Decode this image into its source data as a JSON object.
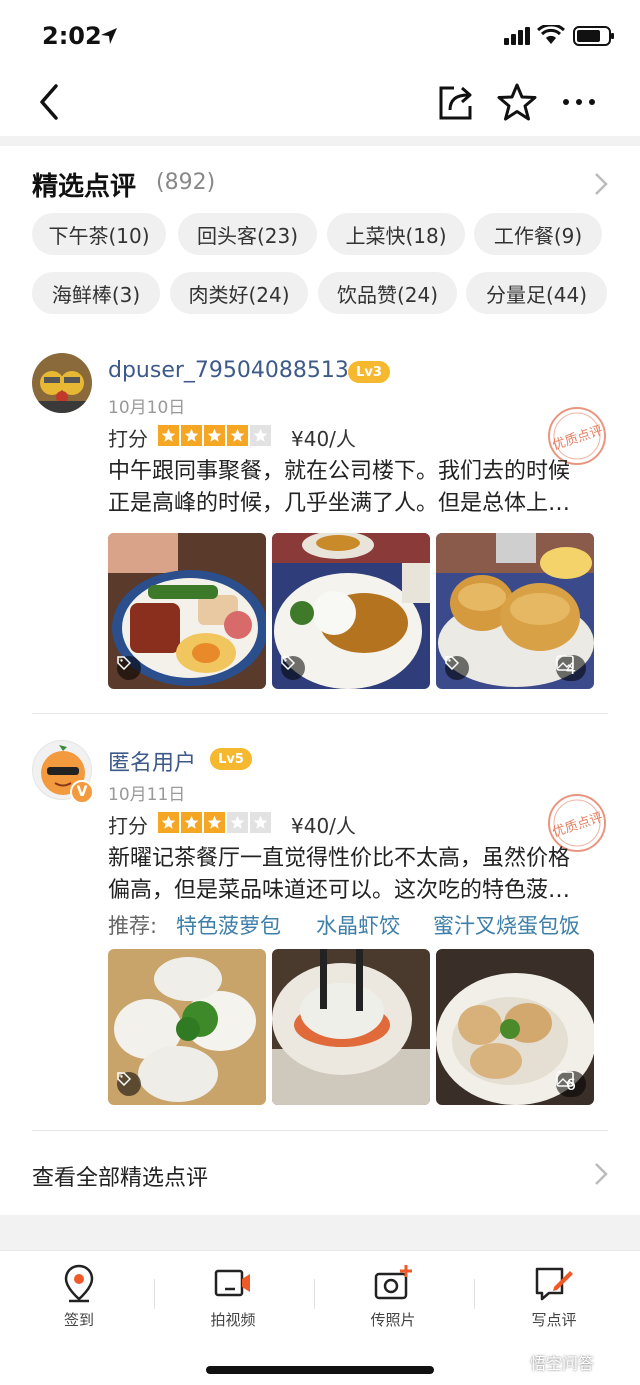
{
  "status_bar": {
    "time": "2:02"
  },
  "section": {
    "title": "精选点评",
    "count": "(892)"
  },
  "tags": [
    "下午茶(10)",
    "回头客(23)",
    "上菜快(18)",
    "工作餐(9)",
    "海鲜棒(3)",
    "肉类好(24)",
    "饮品赞(24)",
    "分量足(44)"
  ],
  "reviews": [
    {
      "username": "dpuser_79504088513",
      "level": "Lv3",
      "date": "10月10日",
      "rating_label": "打分",
      "stars": 4,
      "price": "¥40/人",
      "text_line1": "中午跟同事聚餐，就在公司楼下。我们去的时候",
      "text_line2": "正是高峰的时候，几乎坐满了人。但是总体上…",
      "stamp": "优质点评",
      "photo_count": "4"
    },
    {
      "username": "匿名用户",
      "level": "Lv5",
      "avatar_badge": "V",
      "date": "10月11日",
      "rating_label": "打分",
      "stars": 3,
      "price": "¥40/人",
      "text_line1": "新曜记茶餐厅一直觉得性价比不太高，虽然价格",
      "text_line2": "偏高，但是菜品味道还可以。这次吃的特色菠…",
      "rec_label": "推荐:",
      "recommend": [
        "特色菠萝包",
        "水晶虾饺",
        "蜜汁叉烧蛋包饭"
      ],
      "stamp": "优质点评",
      "photo_count": "6"
    }
  ],
  "see_all": "查看全部精选点评",
  "tabbar": {
    "items": [
      {
        "label": "签到",
        "icon": "location-pin-icon"
      },
      {
        "label": "拍视频",
        "icon": "video-camera-icon"
      },
      {
        "label": "传照片",
        "icon": "photo-upload-icon"
      },
      {
        "label": "写点评",
        "icon": "write-review-icon"
      }
    ]
  },
  "watermark": "悟空问答",
  "colors": {
    "star": "#f5a623",
    "level": "#f5b82e",
    "link": "#3d7fa8",
    "username": "#3d5a8a",
    "stamp": "#e06a4a"
  }
}
